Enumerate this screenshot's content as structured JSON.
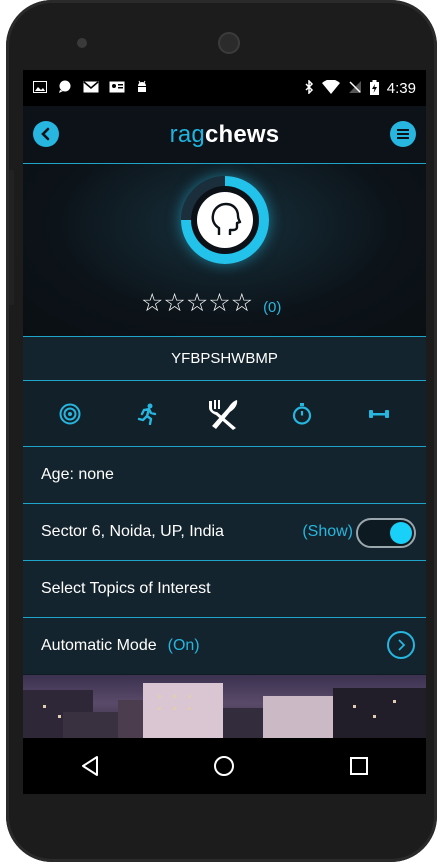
{
  "status_bar": {
    "left_icons": [
      "gallery-icon",
      "chat-icon",
      "gmail-icon",
      "contact-card-icon",
      "android-icon"
    ],
    "time": "4:39"
  },
  "app": {
    "brand_part1": "rag",
    "brand_part2": "chews"
  },
  "profile": {
    "rating_stars": "☆☆☆☆☆",
    "rating_count": "(0)",
    "username": "YFBPSHWBMP"
  },
  "activities": [
    "target-icon",
    "running-icon",
    "fork-knife-icon",
    "stopwatch-icon",
    "dumbbell-icon"
  ],
  "rows": {
    "age": "Age: none",
    "location": "Sector 6, Noida, UP, India",
    "location_show": "(Show)",
    "location_toggle_on": true,
    "topics": "Select Topics of Interest",
    "auto_mode_label": "Automatic Mode",
    "auto_mode_value": "(On)"
  },
  "colors": {
    "accent": "#26b6df",
    "background": "#0f1c24",
    "divider": "#1fa5c9"
  }
}
